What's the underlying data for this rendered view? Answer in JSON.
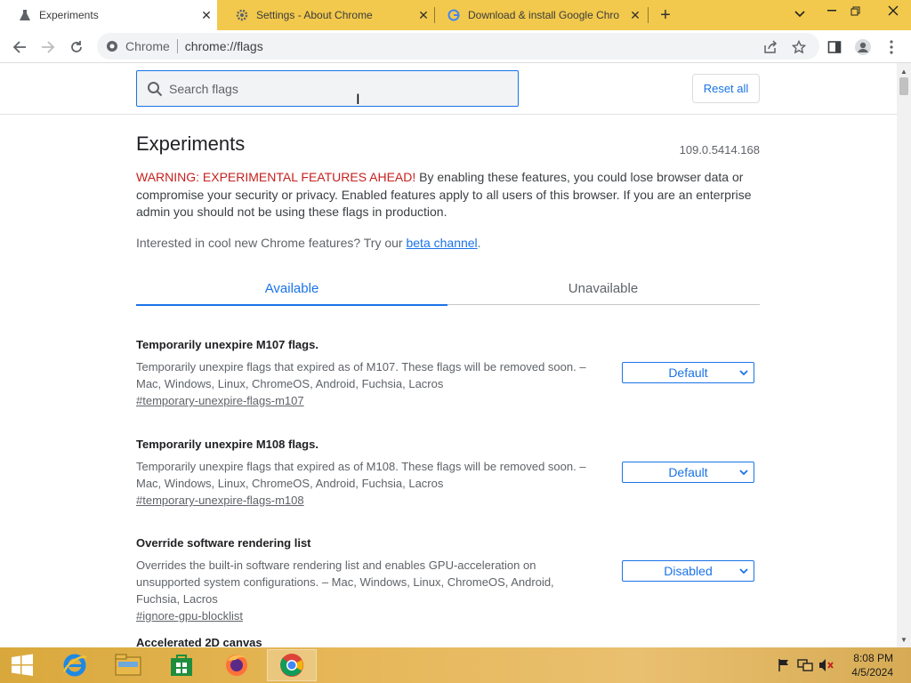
{
  "browser": {
    "tabs": [
      {
        "title": "Experiments",
        "icon": "flask-icon",
        "active": true
      },
      {
        "title": "Settings - About Chrome",
        "icon": "gear-icon",
        "active": false
      },
      {
        "title": "Download & install Google Chro",
        "icon": "google-g-icon",
        "active": false
      }
    ],
    "omnibox": {
      "site_label": "Chrome",
      "url": "chrome://flags"
    }
  },
  "flags_page": {
    "search_placeholder": "Search flags",
    "reset_label": "Reset all",
    "title": "Experiments",
    "version": "109.0.5414.168",
    "warning_strong": "WARNING: EXPERIMENTAL FEATURES AHEAD!",
    "warning_text": " By enabling these features, you could lose browser data or compromise your security or privacy. Enabled features apply to all users of this browser. If you are an enterprise admin you should not be using these flags in production.",
    "interest_text": "Interested in cool new Chrome features? Try our ",
    "beta_link": "beta channel",
    "interest_end": ".",
    "tabs": {
      "available": "Available",
      "unavailable": "Unavailable"
    },
    "flags": [
      {
        "name": "Temporarily unexpire M107 flags.",
        "description": "Temporarily unexpire flags that expired as of M107. These flags will be removed soon. – Mac, Windows, Linux, ChromeOS, Android, Fuchsia, Lacros",
        "link": "#temporary-unexpire-flags-m107",
        "value": "Default"
      },
      {
        "name": "Temporarily unexpire M108 flags.",
        "description": "Temporarily unexpire flags that expired as of M108. These flags will be removed soon. – Mac, Windows, Linux, ChromeOS, Android, Fuchsia, Lacros",
        "link": "#temporary-unexpire-flags-m108",
        "value": "Default"
      },
      {
        "name": "Override software rendering list",
        "description": "Overrides the built-in software rendering list and enables GPU-acceleration on unsupported system configurations. – Mac, Windows, Linux, ChromeOS, Android, Fuchsia, Lacros",
        "link": "#ignore-gpu-blocklist",
        "value": "Disabled"
      },
      {
        "name": "Accelerated 2D canvas"
      }
    ]
  },
  "taskbar": {
    "clock_time": "8:08 PM",
    "clock_date": "4/5/2024"
  },
  "colors": {
    "accent": "#1a73e8",
    "warning": "#c5221f",
    "tabstrip": "#f2c94c"
  }
}
